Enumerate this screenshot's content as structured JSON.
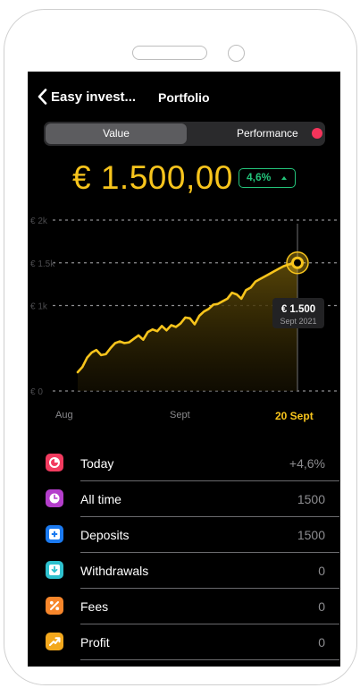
{
  "nav": {
    "back_label": "Easy invest...",
    "title": "Portfolio"
  },
  "segment": {
    "value_label": "Value",
    "performance_label": "Performance",
    "selected": "Value",
    "performance_dot_color": "#f5345b"
  },
  "summary": {
    "amount": "€ 1.500,00",
    "change_badge": "4,6%",
    "change_direction": "up",
    "accent": "#f7c41c",
    "positive_color": "#23c47a"
  },
  "chart_data": {
    "type": "area",
    "ytick_labels": [
      "€ 2k",
      "€ 1.5k",
      "€ 1k",
      "€ 0"
    ],
    "yticks": [
      2000,
      1500,
      1000,
      0
    ],
    "ylim": [
      0,
      2000
    ],
    "x_labels": [
      "Aug",
      "Sept",
      "20 Sept"
    ],
    "selected_x_label": "20 Sept",
    "series": [
      {
        "values": [
          220,
          280,
          390,
          450,
          480,
          420,
          430,
          500,
          560,
          580,
          560,
          570,
          610,
          650,
          600,
          690,
          720,
          700,
          760,
          710,
          770,
          750,
          790,
          860,
          850,
          780,
          880,
          930,
          960,
          1010,
          1020,
          1050,
          1080,
          1150,
          1130,
          1080,
          1180,
          1210,
          1280,
          1310,
          1340,
          1370,
          1400,
          1430,
          1460,
          1480,
          1490,
          1500
        ]
      }
    ],
    "marker": {
      "value": "€ 1.500",
      "date": "Sept 2021"
    },
    "line_color": "#f7c41c"
  },
  "items": [
    {
      "label": "Today",
      "value": "+4,6%",
      "icon": "pie-chart-icon",
      "color": "#f23b5f"
    },
    {
      "label": "All time",
      "value": "1500",
      "icon": "clock-icon",
      "color": "#b43ecb"
    },
    {
      "label": "Deposits",
      "value": "1500",
      "icon": "plus-square-icon",
      "color": "#1b7af0"
    },
    {
      "label": "Withdrawals",
      "value": "0",
      "icon": "download-icon",
      "color": "#2ec1ce"
    },
    {
      "label": "Fees",
      "value": "0",
      "icon": "percent-icon",
      "color": "#f7862b"
    },
    {
      "label": "Profit",
      "value": "0",
      "icon": "trend-up-icon",
      "color": "#f3a81d"
    }
  ]
}
